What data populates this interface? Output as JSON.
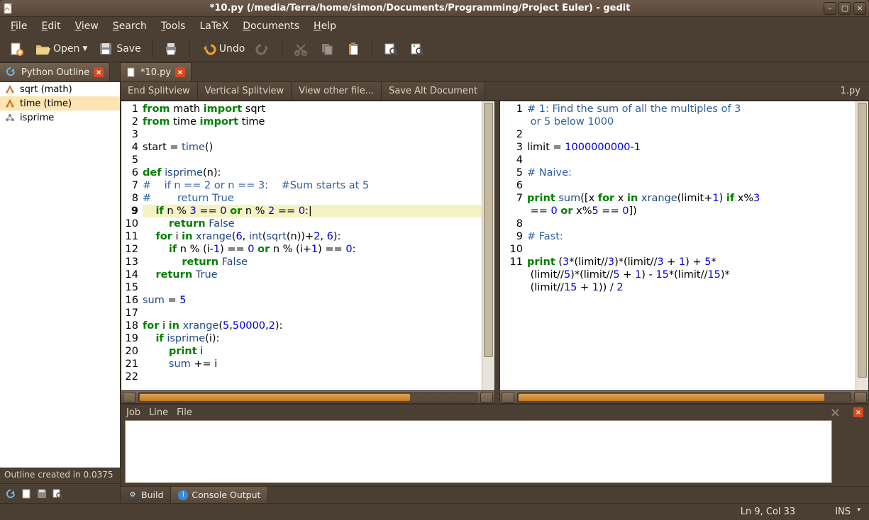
{
  "window": {
    "title": "*10.py (/media/Terra/home/simon/Documents/Programming/Project Euler) - gedit"
  },
  "menubar": [
    "File",
    "Edit",
    "View",
    "Search",
    "Tools",
    "LaTeX",
    "Documents",
    "Help"
  ],
  "toolbar": {
    "open": "Open",
    "save": "Save",
    "undo": "Undo"
  },
  "sidebar": {
    "tab": "Python Outline",
    "items": [
      {
        "label": "sqrt (math)",
        "sel": false,
        "ic": "fn"
      },
      {
        "label": "time (time)",
        "sel": true,
        "ic": "fn"
      },
      {
        "label": "isprime",
        "sel": false,
        "ic": "cls"
      }
    ],
    "status": "Outline created in 0.0375"
  },
  "main": {
    "tabs": [
      {
        "label": "*10.py",
        "active": true
      }
    ],
    "actions": [
      "End Splitview",
      "Vertical Splitview",
      "View other file...",
      "Save Alt Document"
    ],
    "right_file": "1.py"
  },
  "editor_left": {
    "active_line": 9,
    "lines": [
      {
        "n": 1,
        "seg": [
          [
            "kw",
            "from"
          ],
          [
            "id",
            " math "
          ],
          [
            "kw",
            "import"
          ],
          [
            "id",
            " sqrt"
          ]
        ]
      },
      {
        "n": 2,
        "seg": [
          [
            "kw",
            "from"
          ],
          [
            "id",
            " time "
          ],
          [
            "kw",
            "import"
          ],
          [
            "id",
            " time"
          ]
        ]
      },
      {
        "n": 3,
        "seg": []
      },
      {
        "n": 4,
        "seg": [
          [
            "id",
            "start = "
          ],
          [
            "fn",
            "time"
          ],
          [
            "id",
            "()"
          ]
        ]
      },
      {
        "n": 5,
        "seg": []
      },
      {
        "n": 6,
        "seg": [
          [
            "kw",
            "def"
          ],
          [
            "id",
            " "
          ],
          [
            "fn",
            "isprime"
          ],
          [
            "id",
            "(n):"
          ]
        ]
      },
      {
        "n": 7,
        "seg": [
          [
            "cm",
            "#    if n == 2 or n == 3:    #Sum starts at 5"
          ]
        ]
      },
      {
        "n": 8,
        "seg": [
          [
            "cm",
            "#        return True"
          ]
        ]
      },
      {
        "n": 9,
        "seg": [
          [
            "id",
            "    "
          ],
          [
            "kw",
            "if"
          ],
          [
            "id",
            " n % "
          ],
          [
            "num",
            "3"
          ],
          [
            "id",
            " == "
          ],
          [
            "num",
            "0"
          ],
          [
            "id",
            " "
          ],
          [
            "kw",
            "or"
          ],
          [
            "id",
            " n % "
          ],
          [
            "num",
            "2"
          ],
          [
            "id",
            " == "
          ],
          [
            "num",
            "0"
          ],
          [
            "id",
            ":|"
          ]
        ]
      },
      {
        "n": 10,
        "seg": [
          [
            "id",
            "        "
          ],
          [
            "kw",
            "return"
          ],
          [
            "id",
            " "
          ],
          [
            "bool",
            "False"
          ]
        ]
      },
      {
        "n": 11,
        "seg": [
          [
            "id",
            "    "
          ],
          [
            "kw",
            "for"
          ],
          [
            "id",
            " i "
          ],
          [
            "kw",
            "in"
          ],
          [
            "id",
            " "
          ],
          [
            "fn",
            "xrange"
          ],
          [
            "id",
            "("
          ],
          [
            "num",
            "6"
          ],
          [
            "id",
            ", "
          ],
          [
            "fn",
            "int"
          ],
          [
            "id",
            "("
          ],
          [
            "fn",
            "sqrt"
          ],
          [
            "id",
            "(n))+"
          ],
          [
            "num",
            "2"
          ],
          [
            "id",
            ", "
          ],
          [
            "num",
            "6"
          ],
          [
            "id",
            "):"
          ]
        ]
      },
      {
        "n": 12,
        "seg": [
          [
            "id",
            "        "
          ],
          [
            "kw",
            "if"
          ],
          [
            "id",
            " n % (i-"
          ],
          [
            "num",
            "1"
          ],
          [
            "id",
            ") == "
          ],
          [
            "num",
            "0"
          ],
          [
            "id",
            " "
          ],
          [
            "kw",
            "or"
          ],
          [
            "id",
            " n % (i+"
          ],
          [
            "num",
            "1"
          ],
          [
            "id",
            ") == "
          ],
          [
            "num",
            "0"
          ],
          [
            "id",
            ":"
          ]
        ]
      },
      {
        "n": 13,
        "seg": [
          [
            "id",
            "            "
          ],
          [
            "kw",
            "return"
          ],
          [
            "id",
            " "
          ],
          [
            "bool",
            "False"
          ]
        ]
      },
      {
        "n": 14,
        "seg": [
          [
            "id",
            "    "
          ],
          [
            "kw",
            "return"
          ],
          [
            "id",
            " "
          ],
          [
            "bool",
            "True"
          ]
        ]
      },
      {
        "n": 15,
        "seg": []
      },
      {
        "n": 16,
        "seg": [
          [
            "fn",
            "sum"
          ],
          [
            "id",
            " = "
          ],
          [
            "num",
            "5"
          ]
        ]
      },
      {
        "n": 17,
        "seg": []
      },
      {
        "n": 18,
        "seg": [
          [
            "kw",
            "for"
          ],
          [
            "id",
            " i "
          ],
          [
            "kw",
            "in"
          ],
          [
            "id",
            " "
          ],
          [
            "fn",
            "xrange"
          ],
          [
            "id",
            "("
          ],
          [
            "num",
            "5"
          ],
          [
            "id",
            ","
          ],
          [
            "num",
            "50000"
          ],
          [
            "id",
            ","
          ],
          [
            "num",
            "2"
          ],
          [
            "id",
            "):"
          ]
        ]
      },
      {
        "n": 19,
        "seg": [
          [
            "id",
            "    "
          ],
          [
            "kw",
            "if"
          ],
          [
            "id",
            " "
          ],
          [
            "fn",
            "isprime"
          ],
          [
            "id",
            "(i):"
          ]
        ]
      },
      {
        "n": 20,
        "seg": [
          [
            "id",
            "        "
          ],
          [
            "kw",
            "print"
          ],
          [
            "id",
            " i"
          ]
        ]
      },
      {
        "n": 21,
        "seg": [
          [
            "id",
            "        "
          ],
          [
            "fn",
            "sum"
          ],
          [
            "id",
            " += i"
          ]
        ]
      },
      {
        "n": 22,
        "seg": []
      }
    ]
  },
  "editor_right": {
    "lines": [
      {
        "n": 1,
        "seg": [
          [
            "cm",
            "# 1: Find the sum of all the multiples of 3"
          ]
        ]
      },
      {
        "n": "",
        "seg": [
          [
            "cm",
            " or 5 below 1000"
          ]
        ]
      },
      {
        "n": 2,
        "seg": []
      },
      {
        "n": 3,
        "seg": [
          [
            "id",
            "limit = "
          ],
          [
            "num",
            "1000000000"
          ],
          [
            "id",
            "-"
          ],
          [
            "num",
            "1"
          ]
        ]
      },
      {
        "n": 4,
        "seg": []
      },
      {
        "n": 5,
        "seg": [
          [
            "cm",
            "# Naive:"
          ]
        ]
      },
      {
        "n": 6,
        "seg": []
      },
      {
        "n": 7,
        "seg": [
          [
            "kw",
            "print"
          ],
          [
            "id",
            " "
          ],
          [
            "fn",
            "sum"
          ],
          [
            "id",
            "([x "
          ],
          [
            "kw",
            "for"
          ],
          [
            "id",
            " x "
          ],
          [
            "kw",
            "in"
          ],
          [
            "id",
            " "
          ],
          [
            "fn",
            "xrange"
          ],
          [
            "id",
            "(limit+"
          ],
          [
            "num",
            "1"
          ],
          [
            "id",
            ") "
          ],
          [
            "kw",
            "if"
          ],
          [
            "id",
            " x%"
          ],
          [
            "num",
            "3"
          ]
        ]
      },
      {
        "n": "",
        "seg": [
          [
            "id",
            " == "
          ],
          [
            "num",
            "0"
          ],
          [
            "id",
            " "
          ],
          [
            "kw",
            "or"
          ],
          [
            "id",
            " x%"
          ],
          [
            "num",
            "5"
          ],
          [
            "id",
            " == "
          ],
          [
            "num",
            "0"
          ],
          [
            "id",
            "])"
          ]
        ]
      },
      {
        "n": 8,
        "seg": []
      },
      {
        "n": 9,
        "seg": [
          [
            "cm",
            "# Fast:"
          ]
        ]
      },
      {
        "n": 10,
        "seg": []
      },
      {
        "n": 11,
        "seg": [
          [
            "kw",
            "print"
          ],
          [
            "id",
            " ("
          ],
          [
            "num",
            "3"
          ],
          [
            "id",
            "*(limit//"
          ],
          [
            "num",
            "3"
          ],
          [
            "id",
            ")*(limit//"
          ],
          [
            "num",
            "3"
          ],
          [
            "id",
            " + "
          ],
          [
            "num",
            "1"
          ],
          [
            "id",
            ") + "
          ],
          [
            "num",
            "5"
          ],
          [
            "id",
            "*"
          ]
        ]
      },
      {
        "n": "",
        "seg": [
          [
            "id",
            " (limit//"
          ],
          [
            "num",
            "5"
          ],
          [
            "id",
            ")*(limit//"
          ],
          [
            "num",
            "5"
          ],
          [
            "id",
            " + "
          ],
          [
            "num",
            "1"
          ],
          [
            "id",
            ") - "
          ],
          [
            "num",
            "15"
          ],
          [
            "id",
            "*(limit//"
          ],
          [
            "num",
            "15"
          ],
          [
            "id",
            ")*"
          ]
        ]
      },
      {
        "n": "",
        "seg": [
          [
            "id",
            " (limit//"
          ],
          [
            "num",
            "15"
          ],
          [
            "id",
            " + "
          ],
          [
            "num",
            "1"
          ],
          [
            "id",
            ")) / "
          ],
          [
            "num",
            "2"
          ]
        ]
      }
    ]
  },
  "bottom": {
    "cols": [
      "Job",
      "Line",
      "File"
    ],
    "tabs": [
      {
        "label": "Build",
        "active": false
      },
      {
        "label": "Console Output",
        "active": true
      }
    ]
  },
  "status": {
    "pos": "Ln 9, Col 33",
    "ins": "INS"
  }
}
